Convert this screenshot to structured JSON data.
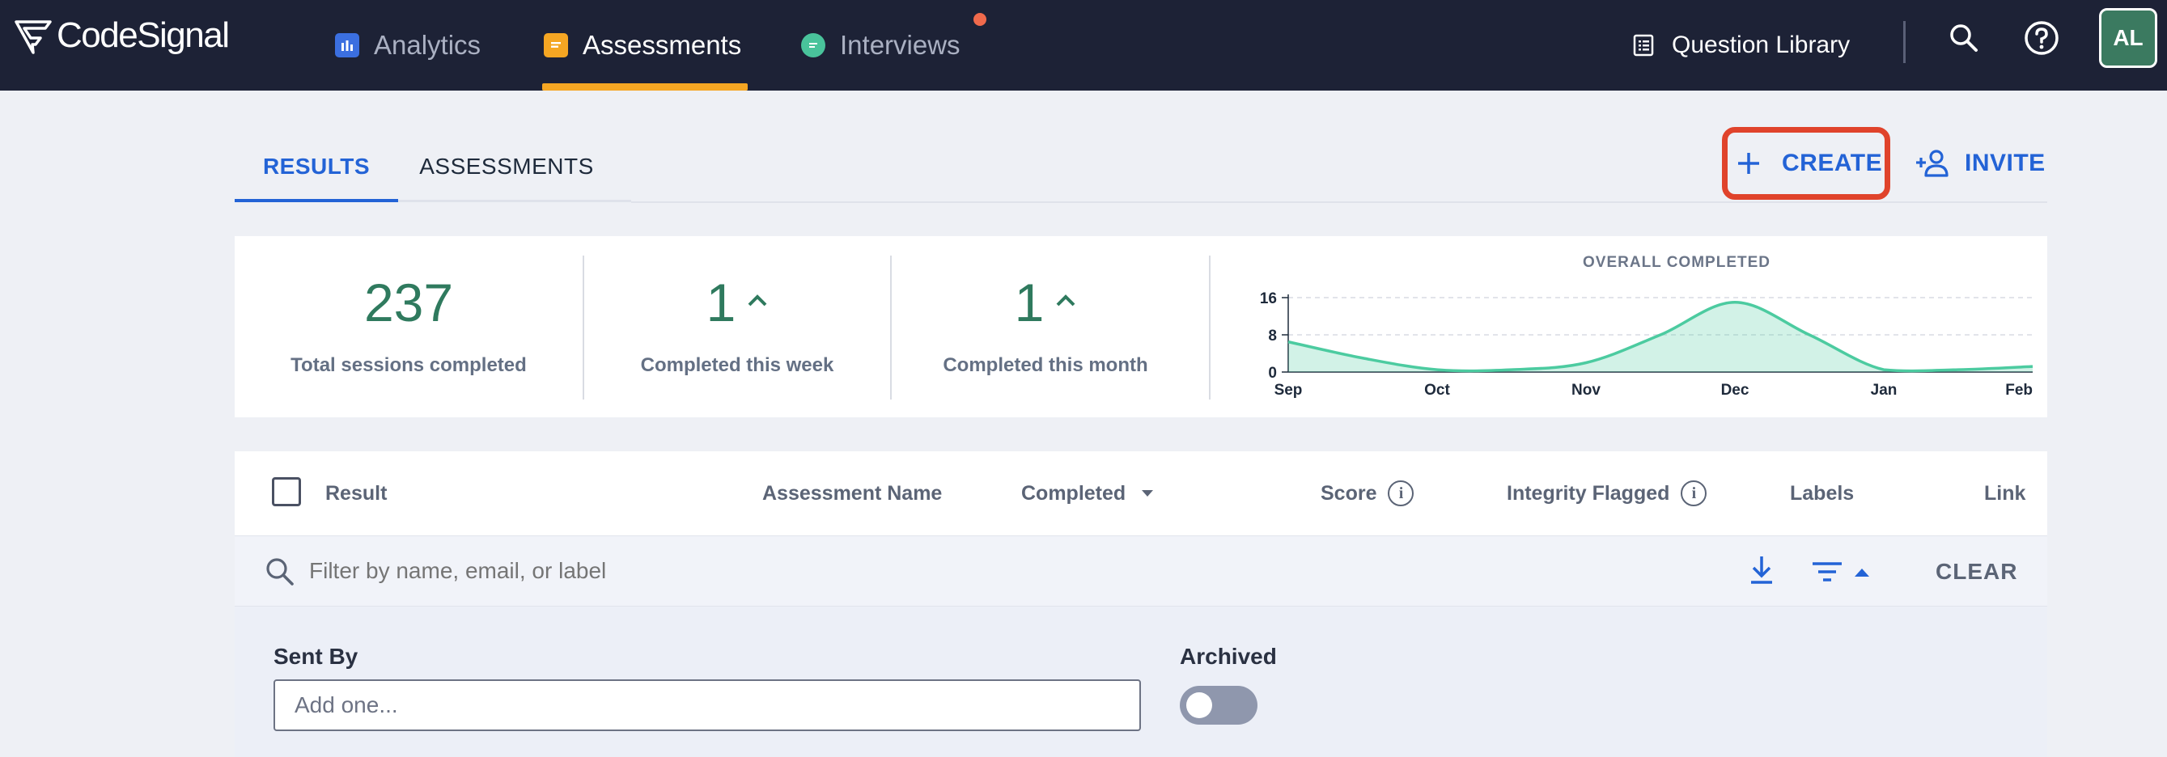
{
  "brand": {
    "name": "CodeSignal"
  },
  "nav": {
    "analytics": "Analytics",
    "assessments": "Assessments",
    "interviews": "Interviews",
    "question_library": "Question Library",
    "avatar_initials": "AL"
  },
  "tabs": {
    "results": "RESULTS",
    "assessments": "ASSESSMENTS"
  },
  "actions": {
    "create": "CREATE",
    "invite": "INVITE"
  },
  "stats": [
    {
      "value": "237",
      "label": "Total sessions completed"
    },
    {
      "value": "1",
      "label": "Completed this week"
    },
    {
      "value": "1",
      "label": "Completed this month"
    }
  ],
  "chart_data": {
    "type": "area",
    "title": "OVERALL COMPLETED",
    "x_ticks": [
      "Sep",
      "Oct",
      "Nov",
      "Dec",
      "Jan",
      "Feb"
    ],
    "y_ticks": [
      0,
      8,
      16
    ],
    "ylim": [
      0,
      16
    ],
    "grid": "dashed horizontal",
    "series": [
      {
        "x": [
          0,
          0.5,
          1,
          1.5,
          2,
          2.5,
          3,
          3.5,
          4,
          4.5,
          5
        ],
        "values": [
          6.5,
          3,
          0.5,
          0.5,
          2,
          8,
          15,
          8,
          0.5,
          0.5,
          1.2
        ]
      }
    ],
    "color": "#4ccba0"
  },
  "table": {
    "headers": {
      "result": "Result",
      "assessment_name": "Assessment Name",
      "completed": "Completed",
      "score": "Score",
      "integrity_flagged": "Integrity Flagged",
      "labels": "Labels",
      "link": "Link"
    },
    "filter_placeholder": "Filter by name, email, or label",
    "clear": "CLEAR"
  },
  "filters": {
    "sent_by_label": "Sent By",
    "sent_by_placeholder": "Add one...",
    "archived_label": "Archived"
  }
}
